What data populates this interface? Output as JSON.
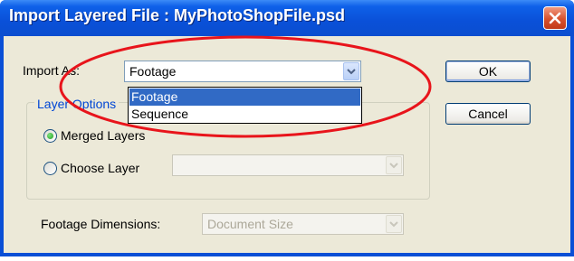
{
  "window": {
    "title": "Import Layered File : MyPhotoShopFile.psd"
  },
  "import_as": {
    "label": "Import As:",
    "selected": "Footage",
    "options": [
      "Footage",
      "Sequence"
    ],
    "highlighted_option": "Footage"
  },
  "layer_options": {
    "legend": "Layer Options",
    "merged_layers_label": "Merged Layers",
    "choose_layer_label": "Choose Layer",
    "merged_layers_checked": true,
    "choose_layer_checked": false,
    "choose_layer_value": ""
  },
  "footage_dimensions": {
    "label": "Footage Dimensions:",
    "value": "Document Size"
  },
  "buttons": {
    "ok_label": "OK",
    "cancel_label": "Cancel"
  },
  "colors": {
    "title_bar": "#0a50d8",
    "dialog_bg": "#ece9d8",
    "selection": "#316ac5",
    "annotation_ellipse": "#e8141b",
    "group_legend": "#0046d5"
  }
}
